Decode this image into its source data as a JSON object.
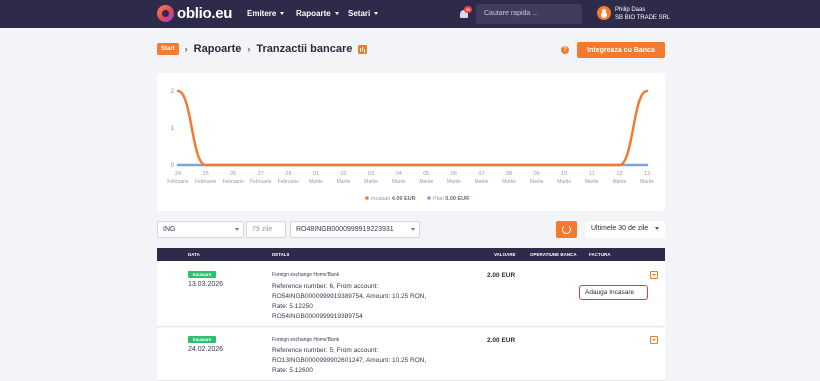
{
  "brand": {
    "logo_text": "oblio.eu"
  },
  "nav": {
    "items": [
      {
        "label": "Emitere"
      },
      {
        "label": "Rapoarte"
      },
      {
        "label": "Setari"
      }
    ]
  },
  "notifications": {
    "count": "99"
  },
  "search": {
    "placeholder": "Cautare rapida ..."
  },
  "user": {
    "name": "Philip Daas",
    "company": "SB BIO TRADE SRL"
  },
  "breadcrumb": {
    "home": "Start",
    "section": "Rapoarte",
    "page": "Tranzactii bancare"
  },
  "actions": {
    "integrate_label": "Integreaza cu Banca",
    "help": "?"
  },
  "colors": {
    "accent": "#f47a2f",
    "navbar": "#2d2a4a",
    "income": "#f47a2f",
    "payments": "#7aa6d8",
    "badge_green": "#2fbf71",
    "popup_border": "#e63b3b"
  },
  "chart_data": {
    "type": "line",
    "categories": [
      "24 Februarie",
      "25 Februarie",
      "26 Februarie",
      "27 Februarie",
      "28 Februarie",
      "01 Martie",
      "02 Martie",
      "03 Martie",
      "04 Martie",
      "05 Martie",
      "06 Martie",
      "07 Martie",
      "08 Martie",
      "09 Martie",
      "10 Martie",
      "11 Martie",
      "12 Martie",
      "13 Martie"
    ],
    "x_labels": [
      [
        "24",
        "Februarie"
      ],
      [
        "25",
        "Februarie"
      ],
      [
        "26",
        "Februarie"
      ],
      [
        "27",
        "Februarie"
      ],
      [
        "28",
        "Februarie"
      ],
      [
        "01",
        "Martie"
      ],
      [
        "02",
        "Martie"
      ],
      [
        "03",
        "Martie"
      ],
      [
        "04",
        "Martie"
      ],
      [
        "05",
        "Martie"
      ],
      [
        "06",
        "Martie"
      ],
      [
        "07",
        "Martie"
      ],
      [
        "08",
        "Martie"
      ],
      [
        "09",
        "Martie"
      ],
      [
        "10",
        "Martie"
      ],
      [
        "11",
        "Martie"
      ],
      [
        "12",
        "Martie"
      ],
      [
        "13",
        "Martie"
      ]
    ],
    "yticks": [
      "0",
      "1",
      "2"
    ],
    "ylim": [
      0,
      2
    ],
    "series": [
      {
        "name": "Incasari",
        "total": "4.00 EUR",
        "color": "#f47a2f",
        "values": [
          2,
          0,
          0,
          0,
          0,
          0,
          0,
          0,
          0,
          0,
          0,
          0,
          0,
          0,
          0,
          0,
          0,
          2
        ]
      },
      {
        "name": "Plati",
        "total": "0.00 EUR",
        "color": "#7aa6d8",
        "values": [
          0,
          0,
          0,
          0,
          0,
          0,
          0,
          0,
          0,
          0,
          0,
          0,
          0,
          0,
          0,
          0,
          0,
          0
        ]
      }
    ],
    "legend_position": "bottom-center",
    "grid": false
  },
  "filters": {
    "bank": "ING",
    "days": "79 zile",
    "iban": "RO48INGB0000999919223931",
    "period": "Ultimele 30 de zile"
  },
  "table": {
    "headers": {
      "date": "DATA",
      "details": "DETALII",
      "value": "VALOARE",
      "bank_op": "OPERATIUNE BANCA",
      "invoice": "FACTURA"
    },
    "rows": [
      {
        "badge": "Incasare",
        "date": "13.03.2026",
        "title": "Foreign exchange Home'Bank",
        "lines": [
          "Reference number: 6, From account:",
          "RO54INGB0000999919389754, Amount: 10.25 RON,",
          "Rate: 5.12250",
          "RO54INGB0000999919389754"
        ],
        "value": "2.00 EUR"
      },
      {
        "badge": "Incasare",
        "date": "24.02.2026",
        "title": "Foreign exchange Home'Bank",
        "lines": [
          "Reference number: 5, From account:",
          "RO13INGB0000999902601247, Amount: 10.25 RON,",
          "Rate: 5.12600"
        ],
        "value": "2.00 EUR"
      }
    ],
    "popup_label": "Adauga Incasare"
  }
}
